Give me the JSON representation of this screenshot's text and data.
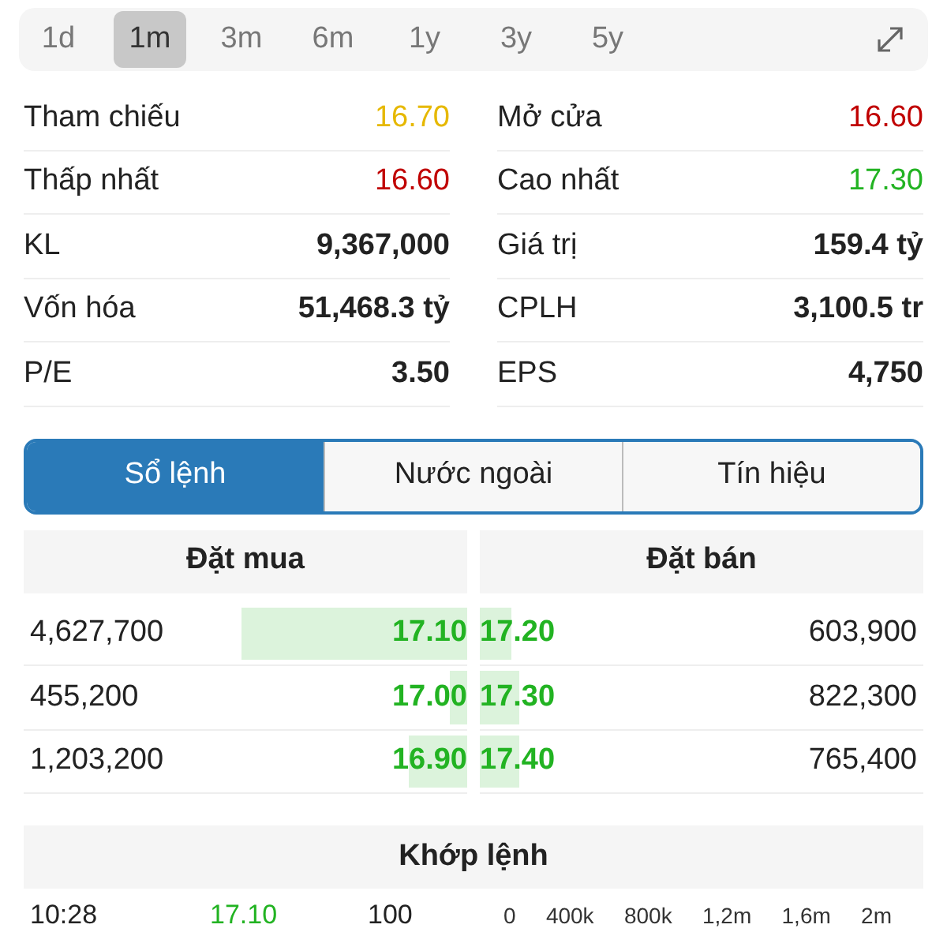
{
  "periods": [
    {
      "label": "1d",
      "selected": false
    },
    {
      "label": "1m",
      "selected": true
    },
    {
      "label": "3m",
      "selected": false
    },
    {
      "label": "6m",
      "selected": false
    },
    {
      "label": "1y",
      "selected": false
    },
    {
      "label": "3y",
      "selected": false
    },
    {
      "label": "5y",
      "selected": false
    }
  ],
  "stats": [
    [
      {
        "label": "Tham chiếu",
        "value": "16.70",
        "kind": "price",
        "color": "#e6b800"
      },
      {
        "label": "Mở cửa",
        "value": "16.60",
        "kind": "price",
        "color": "#c00000"
      }
    ],
    [
      {
        "label": "Thấp nhất",
        "value": "16.60",
        "kind": "price",
        "color": "#c00000"
      },
      {
        "label": "Cao nhất",
        "value": "17.30",
        "kind": "price",
        "color": "#22b322"
      }
    ],
    [
      {
        "label": "KL",
        "value": "9,367,000",
        "kind": "amount",
        "color": "#222222"
      },
      {
        "label": "Giá trị",
        "value": "159.4 tỷ",
        "kind": "amount",
        "color": "#222222"
      }
    ],
    [
      {
        "label": "Vốn hóa",
        "value": "51,468.3 tỷ",
        "kind": "amount",
        "color": "#222222"
      },
      {
        "label": "CPLH",
        "value": "3,100.5 tr",
        "kind": "amount",
        "color": "#222222"
      }
    ],
    [
      {
        "label": "P/E",
        "value": "3.50",
        "kind": "amount",
        "color": "#222222"
      },
      {
        "label": "EPS",
        "value": "4,750",
        "kind": "amount",
        "color": "#222222"
      }
    ]
  ],
  "tabs": [
    {
      "label": "Sổ lệnh",
      "selected": true
    },
    {
      "label": "Nước ngoài",
      "selected": false
    },
    {
      "label": "Tín hiệu",
      "selected": false
    }
  ],
  "order_book": {
    "bid_header": "Đặt mua",
    "ask_header": "Đặt bán",
    "rows": [
      {
        "bid": {
          "volume": "4,627,700",
          "price": "17.10",
          "level": 0.51
        },
        "ask": {
          "price": "17.20",
          "volume": "603,900",
          "level": 0.07
        }
      },
      {
        "bid": {
          "volume": "455,200",
          "price": "17.00",
          "level": 0.04
        },
        "ask": {
          "price": "17.30",
          "volume": "822,300",
          "level": 0.09
        }
      },
      {
        "bid": {
          "volume": "1,203,200",
          "price": "16.90",
          "level": 0.13
        },
        "ask": {
          "price": "17.40",
          "volume": "765,400",
          "level": 0.09
        }
      }
    ]
  },
  "matched": {
    "header": "Khớp lệnh",
    "trades": [
      {
        "time": "10:28",
        "price": "17.10",
        "volume": "100",
        "color": "#22b322"
      }
    ],
    "volume_axis_ticks": [
      "0",
      "400k",
      "800k",
      "1,2m",
      "1,6m",
      "2m"
    ]
  }
}
